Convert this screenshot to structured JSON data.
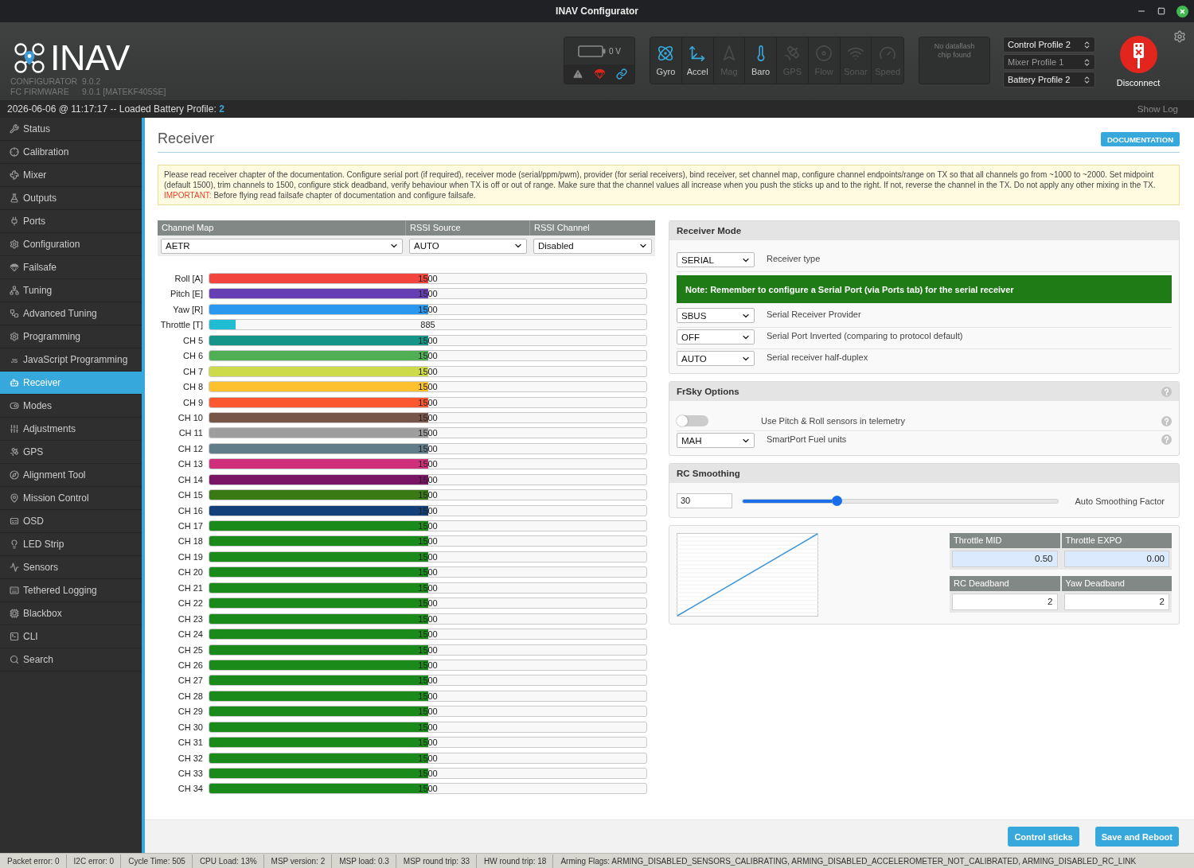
{
  "window": {
    "title": "INAV Configurator"
  },
  "header": {
    "logo": "INAV",
    "versions": [
      {
        "label": "CONFIGURATOR",
        "value": "9.0.2"
      },
      {
        "label": "FC FIRMWARE",
        "value": "9.0.1 [MATEKF405SE]"
      }
    ],
    "battery": {
      "reading": "0 V"
    },
    "sensors": [
      {
        "label": "Gyro",
        "active": true
      },
      {
        "label": "Accel",
        "active": true
      },
      {
        "label": "Mag",
        "active": false
      },
      {
        "label": "Baro",
        "active": true
      },
      {
        "label": "GPS",
        "active": false
      },
      {
        "label": "Flow",
        "active": false
      },
      {
        "label": "Sonar",
        "active": false
      },
      {
        "label": "Speed",
        "active": false
      }
    ],
    "dataflash": "No dataflash chip found",
    "profiles": [
      {
        "label": "Control Profile 2",
        "disabled": false
      },
      {
        "label": "Mixer Profile 1",
        "disabled": true
      },
      {
        "label": "Battery Profile 2",
        "disabled": false
      }
    ],
    "disconnect": "Disconnect"
  },
  "log": {
    "message": "2026-06-06 @ 11:17:17 -- Loaded Battery Profile: **2**",
    "show_log": "Show Log"
  },
  "sidebar": {
    "items": [
      {
        "label": "Status",
        "selected": false
      },
      {
        "label": "Calibration",
        "selected": false
      },
      {
        "label": "Mixer",
        "selected": false
      },
      {
        "label": "Outputs",
        "selected": false
      },
      {
        "label": "Ports",
        "selected": false
      },
      {
        "label": "Configuration",
        "selected": false
      },
      {
        "label": "Failsafe",
        "selected": false
      },
      {
        "label": "Tuning",
        "selected": false
      },
      {
        "label": "Advanced Tuning",
        "selected": false
      },
      {
        "label": "Programming",
        "selected": false
      },
      {
        "label": "JavaScript Programming",
        "selected": false,
        "icon_text": "JS"
      },
      {
        "label": "Receiver",
        "selected": true
      },
      {
        "label": "Modes",
        "selected": false
      },
      {
        "label": "Adjustments",
        "selected": false
      },
      {
        "label": "GPS",
        "selected": false
      },
      {
        "label": "Alignment Tool",
        "selected": false
      },
      {
        "label": "Mission Control",
        "selected": false
      },
      {
        "label": "OSD",
        "selected": false
      },
      {
        "label": "LED Strip",
        "selected": false
      },
      {
        "label": "Sensors",
        "selected": false
      },
      {
        "label": "Tethered Logging",
        "selected": false
      },
      {
        "label": "Blackbox",
        "selected": false
      },
      {
        "label": "CLI",
        "selected": false
      },
      {
        "label": "Search",
        "selected": false
      }
    ]
  },
  "page": {
    "title": "Receiver",
    "documentation": "DOCUMENTATION",
    "notice": {
      "text": "Please read receiver chapter of the documentation. Configure serial port (if required), receiver mode (serial/ppm/pwm), provider (for serial receivers), bind receiver, set channel map, configure channel endpoints/range on TX so that all channels go from ~1000 to ~2000. Set midpoint (default 1500), trim channels to 1500, configure stick deadband, verify behaviour when TX is off or out of range. Make sure that the channel values all increase when you push the sticks up and to the right. If not, reverse the channel in the TX. Do not apply any other mixing in the TX.",
      "important_label": "IMPORTANT:",
      "important_text": "Before flying read failsafe chapter of documentation and configure failsafe."
    }
  },
  "channel_map": {
    "columns": [
      "Channel Map",
      "RSSI Source",
      "RSSI Channel"
    ],
    "values": [
      "AETR",
      "AUTO",
      "Disabled"
    ]
  },
  "channels": [
    {
      "label": "Roll [A]",
      "value": "1500",
      "level": 0.5,
      "color": "#f1453d"
    },
    {
      "label": "Pitch [E]",
      "value": "1500",
      "level": 0.5,
      "color": "#673fb4"
    },
    {
      "label": "Yaw [R]",
      "value": "1500",
      "level": 0.5,
      "color": "#2b98f0"
    },
    {
      "label": "Throttle [T]",
      "value": "885",
      "level": 0.061,
      "color": "#1fbcd2"
    },
    {
      "label": "CH 5",
      "value": "1500",
      "level": 0.5,
      "color": "#159588"
    },
    {
      "label": "CH 6",
      "value": "1500",
      "level": 0.5,
      "color": "#50ae55"
    },
    {
      "label": "CH 7",
      "value": "1500",
      "level": 0.5,
      "color": "#cdda49"
    },
    {
      "label": "CH 8",
      "value": "1500",
      "level": 0.5,
      "color": "#fdc02f"
    },
    {
      "label": "CH 9",
      "value": "1500",
      "level": 0.5,
      "color": "#fc5830"
    },
    {
      "label": "CH 10",
      "value": "1500",
      "level": 0.5,
      "color": "#785549"
    },
    {
      "label": "CH 11",
      "value": "1500",
      "level": 0.5,
      "color": "#9e9e9e"
    },
    {
      "label": "CH 12",
      "value": "1500",
      "level": 0.5,
      "color": "#617d8a"
    },
    {
      "label": "CH 13",
      "value": "1500",
      "level": 0.5,
      "color": "#cf2f7a"
    },
    {
      "label": "CH 14",
      "value": "1500",
      "level": 0.5,
      "color": "#7a1464"
    },
    {
      "label": "CH 15",
      "value": "1500",
      "level": 0.5,
      "color": "#3a7a14"
    },
    {
      "label": "CH 16",
      "value": "1500",
      "level": 0.5,
      "color": "#14407a"
    },
    {
      "label": "CH 17",
      "value": "1500",
      "level": 0.5,
      "color": "#1a8a1a"
    },
    {
      "label": "CH 18",
      "value": "1500",
      "level": 0.5,
      "color": "#1a8a1a"
    },
    {
      "label": "CH 19",
      "value": "1500",
      "level": 0.5,
      "color": "#1a8a1a"
    },
    {
      "label": "CH 20",
      "value": "1500",
      "level": 0.5,
      "color": "#1a8a1a"
    },
    {
      "label": "CH 21",
      "value": "1500",
      "level": 0.5,
      "color": "#1a8a1a"
    },
    {
      "label": "CH 22",
      "value": "1500",
      "level": 0.5,
      "color": "#1a8a1a"
    },
    {
      "label": "CH 23",
      "value": "1500",
      "level": 0.5,
      "color": "#1a8a1a"
    },
    {
      "label": "CH 24",
      "value": "1500",
      "level": 0.5,
      "color": "#1a8a1a"
    },
    {
      "label": "CH 25",
      "value": "1500",
      "level": 0.5,
      "color": "#1a8a1a"
    },
    {
      "label": "CH 26",
      "value": "1500",
      "level": 0.5,
      "color": "#1a8a1a"
    },
    {
      "label": "CH 27",
      "value": "1500",
      "level": 0.5,
      "color": "#1a8a1a"
    },
    {
      "label": "CH 28",
      "value": "1500",
      "level": 0.5,
      "color": "#1a8a1a"
    },
    {
      "label": "CH 29",
      "value": "1500",
      "level": 0.5,
      "color": "#1a8a1a"
    },
    {
      "label": "CH 30",
      "value": "1500",
      "level": 0.5,
      "color": "#1a8a1a"
    },
    {
      "label": "CH 31",
      "value": "1500",
      "level": 0.5,
      "color": "#1a8a1a"
    },
    {
      "label": "CH 32",
      "value": "1500",
      "level": 0.5,
      "color": "#1a8a1a"
    },
    {
      "label": "CH 33",
      "value": "1500",
      "level": 0.5,
      "color": "#1a8a1a"
    },
    {
      "label": "CH 34",
      "value": "1500",
      "level": 0.5,
      "color": "#1a8a1a"
    }
  ],
  "receiver_mode": {
    "title": "Receiver Mode",
    "rows": [
      {
        "kind": "select",
        "value": "SERIAL",
        "label": "Receiver type"
      },
      {
        "kind": "note",
        "text": "Note: Remember to configure a Serial Port (via Ports tab) for the serial receiver"
      },
      {
        "kind": "select",
        "value": "SBUS",
        "label": "Serial Receiver Provider"
      },
      {
        "kind": "select",
        "value": "OFF",
        "label": "Serial Port Inverted (comparing to protocol default)"
      },
      {
        "kind": "select",
        "value": "AUTO",
        "label": "Serial receiver half-duplex"
      }
    ]
  },
  "frsky": {
    "title": "FrSky Options",
    "help": true,
    "rows": [
      {
        "kind": "toggle",
        "on": false,
        "label": "Use Pitch & Roll sensors in telemetry",
        "help": true
      },
      {
        "kind": "select",
        "value": "MAH",
        "label": "SmartPort Fuel units",
        "help": true
      }
    ]
  },
  "rc_smoothing": {
    "title": "RC Smoothing",
    "value": "30",
    "level": 0.3,
    "label": "Auto Smoothing Factor"
  },
  "throttle": {
    "groups": [
      {
        "kind": "curve",
        "fields": [
          {
            "label": "Throttle MID",
            "value": "0.50"
          },
          {
            "label": "Throttle EXPO",
            "value": "0.00"
          }
        ]
      },
      {
        "kind": "deadband",
        "fields": [
          {
            "label": "RC Deadband",
            "value": "2"
          },
          {
            "label": "Yaw Deadband",
            "value": "2"
          }
        ]
      }
    ]
  },
  "footer": {
    "buttons": [
      "Control sticks",
      "Save and Reboot"
    ]
  },
  "status_bar": {
    "items": [
      "Packet error: 0",
      "I2C error: 0",
      "Cycle Time: 505",
      "CPU Load: 13%",
      "MSP version: 2",
      "MSP load: 0.3",
      "MSP round trip: 33",
      "HW round trip: 18",
      "Arming Flags: ARMING_DISABLED_SENSORS_CALIBRATING, ARMING_DISABLED_ACCELEROMETER_NOT_CALIBRATED, ARMING_DISABLED_RC_LINK"
    ]
  }
}
